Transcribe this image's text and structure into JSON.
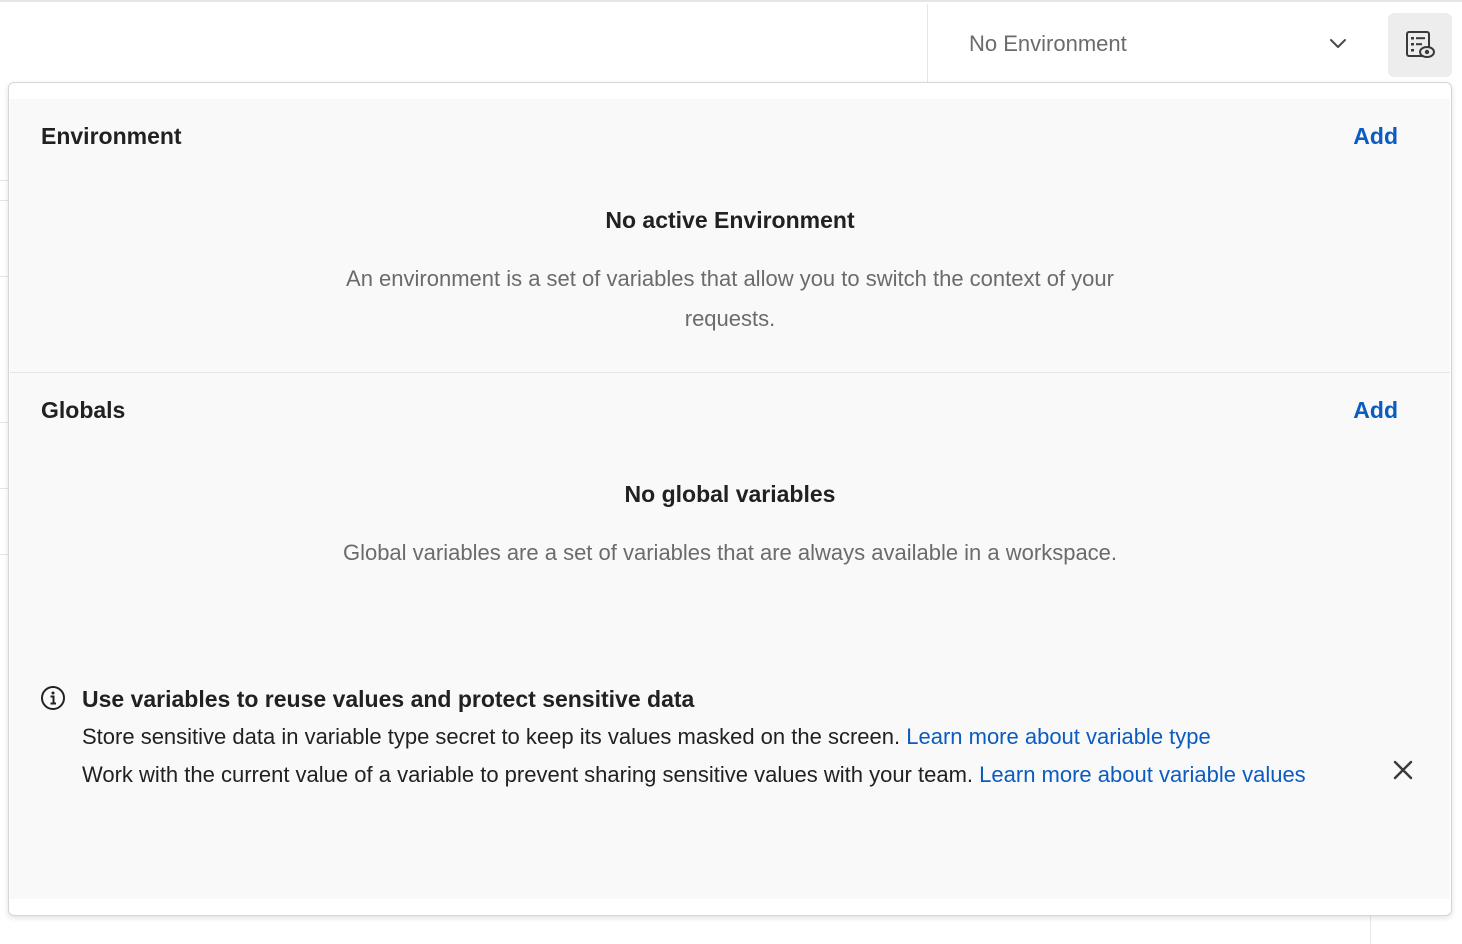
{
  "header": {
    "environment_select_label": "No Environment"
  },
  "icons": {
    "chevron": "chevron-down-icon",
    "environment_quick_look": "environment-eye-icon",
    "info": "info-icon",
    "close": "close-icon"
  },
  "colors": {
    "link": "#0b5cc1",
    "panel_bg": "#f9f9f9",
    "muted_text": "#6b6b6b"
  },
  "environment": {
    "title": "Environment",
    "add_label": "Add",
    "empty_title": "No active Environment",
    "empty_description": "An environment is a set of variables that allow you to switch the context of your requests."
  },
  "globals": {
    "title": "Globals",
    "add_label": "Add",
    "empty_title": "No global variables",
    "empty_description": "Global variables are a set of variables that are always available in a workspace."
  },
  "info_banner": {
    "title": "Use variables to reuse values and protect sensitive data",
    "line1_text": "Store sensitive data in variable type secret to keep its values masked on the screen.",
    "line1_link": "Learn more about variable type",
    "line2_text": "Work with the current value of a variable to prevent sharing sensitive values with your team.",
    "line2_link": "Learn more about variable values"
  }
}
